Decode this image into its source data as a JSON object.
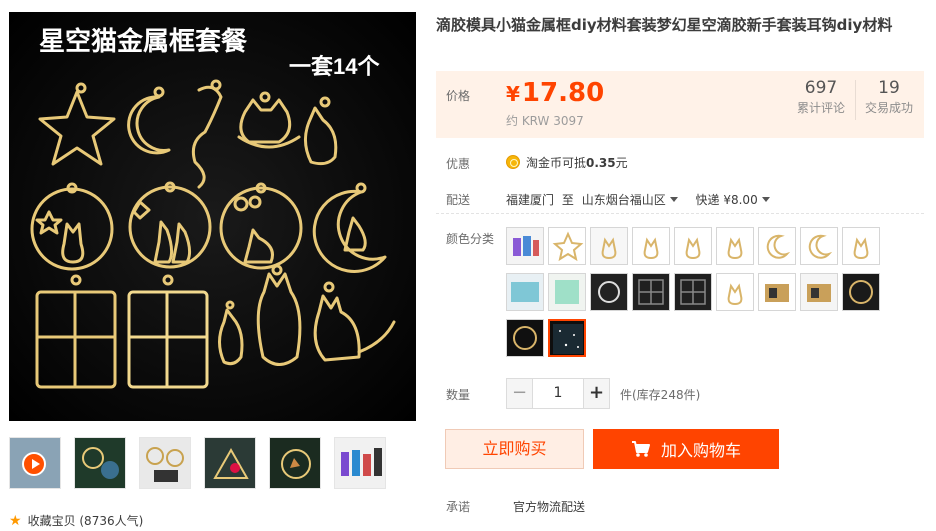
{
  "gallery": {
    "overlay_title": "星空猫金属框套餐",
    "overlay_subtitle": "一套14个",
    "favorite_label": "收藏宝贝 (8736人气)"
  },
  "product": {
    "title": "滴胶模具小猫金属框diy材料套装梦幻星空滴胶新手套装耳钩diy材料"
  },
  "price": {
    "label": "价格",
    "currency": "¥",
    "value": "17.80",
    "krw": "约 KRW 3097",
    "reviews_count": "697",
    "reviews_label": "累计评论",
    "sales_count": "19",
    "sales_label": "交易成功"
  },
  "promo": {
    "label": "优惠",
    "text_prefix": "淘金币可抵",
    "amount": "0.35",
    "unit": "元"
  },
  "delivery": {
    "label": "配送",
    "from": "福建厦门",
    "to_word": "至",
    "to": "山东烟台福山区",
    "method": "快递 ¥8.00"
  },
  "color": {
    "label": "颜色分类",
    "selected_index": 19,
    "option_count": 20
  },
  "quantity": {
    "label": "数量",
    "value": "1",
    "minus": "−",
    "plus": "+",
    "stock": "件(库存248件)"
  },
  "actions": {
    "buy_now": "立即购买",
    "add_to_cart": "加入购物车"
  },
  "promise": {
    "label": "承诺",
    "text": "官方物流配送"
  },
  "colors": {
    "accent": "#ff4400",
    "price_bg": "#fff2e8",
    "gold": "#d9b56a"
  }
}
